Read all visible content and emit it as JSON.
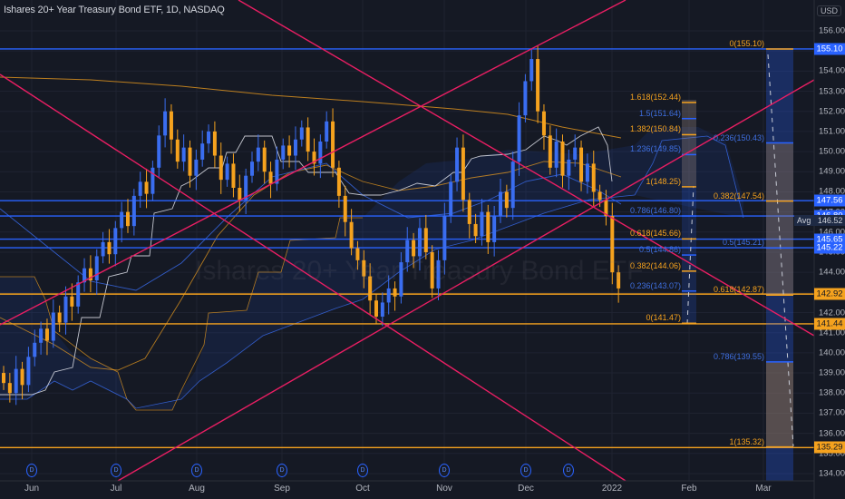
{
  "header": {
    "title": "Ishares 20+ Year Treasury Bond ETF, 1D, NASDAQ",
    "currency": "USD"
  },
  "watermark": "Ishares 20+ Year Treasury Bond ETF",
  "colors": {
    "background": "#151924",
    "up": "#3a6df0",
    "down": "#f5a21e",
    "trendline": "#e91e63",
    "fib_orange": "#f5a21e",
    "fib_blue": "#2962ff"
  },
  "chart_data": {
    "type": "candlestick",
    "title": "Ishares 20+ Year Treasury Bond ETF, 1D, NASDAQ",
    "xlabel": "",
    "ylabel": "USD",
    "ylim": [
      133.6,
      156.5
    ],
    "y_ticks": [
      "156.00",
      "155.00",
      "154.00",
      "153.00",
      "152.00",
      "151.00",
      "150.00",
      "149.00",
      "148.00",
      "147.00",
      "146.00",
      "145.00",
      "144.00",
      "143.00",
      "142.00",
      "141.00",
      "140.00",
      "139.00",
      "138.00",
      "137.00",
      "136.00",
      "135.00",
      "134.00"
    ],
    "x_ticks": [
      "Jun",
      "Jul",
      "Aug",
      "Sep",
      "Oct",
      "Nov",
      "Dec",
      "2022",
      "Feb",
      "Mar"
    ],
    "closes": [
      138.5,
      138.0,
      139.2,
      138.4,
      139.8,
      140.5,
      141.2,
      140.6,
      142.0,
      141.5,
      142.8,
      142.3,
      143.5,
      144.2,
      143.6,
      144.8,
      145.5,
      144.9,
      146.2,
      147.0,
      146.3,
      147.8,
      148.5,
      147.9,
      149.2,
      150.8,
      152.0,
      150.6,
      149.5,
      150.2,
      148.8,
      149.6,
      150.4,
      151.0,
      149.8,
      148.6,
      149.4,
      148.2,
      147.6,
      148.8,
      149.5,
      150.2,
      149.0,
      148.4,
      149.6,
      150.3,
      149.8,
      150.6,
      151.2,
      150.0,
      149.4,
      150.5,
      151.5,
      149.2,
      147.8,
      146.5,
      145.2,
      144.6,
      143.8,
      142.6,
      141.8,
      142.5,
      143.2,
      142.8,
      144.5,
      145.6,
      144.8,
      146.2,
      145.0,
      143.2,
      144.6,
      146.8,
      148.5,
      150.2,
      147.6,
      146.4,
      145.8,
      147.0,
      145.5,
      146.8,
      148.0,
      147.2,
      149.5,
      151.8,
      153.5,
      154.6,
      152.0,
      150.8,
      149.2,
      150.5,
      148.8,
      149.6,
      150.2,
      148.5,
      149.4,
      148.0,
      147.6,
      146.8,
      144.0,
      143.2
    ],
    "price_labels": [
      {
        "value": "155.10",
        "color": "blue"
      },
      {
        "value": "147.56",
        "color": "blue"
      },
      {
        "value": "146.80",
        "color": "blue"
      },
      {
        "value": "145.65",
        "color": "blue"
      },
      {
        "value": "145.22",
        "color": "blue"
      },
      {
        "value": "142.92",
        "color": "orange"
      },
      {
        "value": "141.44",
        "color": "orange"
      },
      {
        "value": "135.29",
        "color": "orange"
      }
    ],
    "avg": {
      "label": "Avg",
      "value": "146.52"
    },
    "fib_left": [
      {
        "label": "1.618(152.44)",
        "price": 152.44,
        "color": "orange"
      },
      {
        "label": "1.5(151.64)",
        "price": 151.64,
        "color": "blue"
      },
      {
        "label": "1.382(150.84)",
        "price": 150.84,
        "color": "orange"
      },
      {
        "label": "1.236(149.85)",
        "price": 149.85,
        "color": "blue"
      },
      {
        "label": "1(148.25)",
        "price": 148.25,
        "color": "orange"
      },
      {
        "label": "0.786(146.80)",
        "price": 146.8,
        "color": "blue"
      },
      {
        "label": "0.618(145.66)",
        "price": 145.66,
        "color": "orange"
      },
      {
        "label": "0.5(144.86)",
        "price": 144.86,
        "color": "blue"
      },
      {
        "label": "0.382(144.06)",
        "price": 144.06,
        "color": "orange"
      },
      {
        "label": "0.236(143.07)",
        "price": 143.07,
        "color": "blue"
      },
      {
        "label": "0(141.47)",
        "price": 141.47,
        "color": "orange"
      }
    ],
    "fib_right": [
      {
        "label": "0(155.10)",
        "price": 155.1,
        "color": "orange"
      },
      {
        "label": "0.236(150.43)",
        "price": 150.43,
        "color": "blue"
      },
      {
        "label": "0.382(147.54)",
        "price": 147.54,
        "color": "orange"
      },
      {
        "label": "0.5(145.21)",
        "price": 145.21,
        "color": "blue"
      },
      {
        "label": "0.618(142.87)",
        "price": 142.87,
        "color": "orange"
      },
      {
        "label": "0.786(139.55)",
        "price": 139.55,
        "color": "blue"
      },
      {
        "label": "1(135.32)",
        "price": 135.32,
        "color": "orange"
      }
    ],
    "dividend_marker": "D",
    "grid": true
  }
}
